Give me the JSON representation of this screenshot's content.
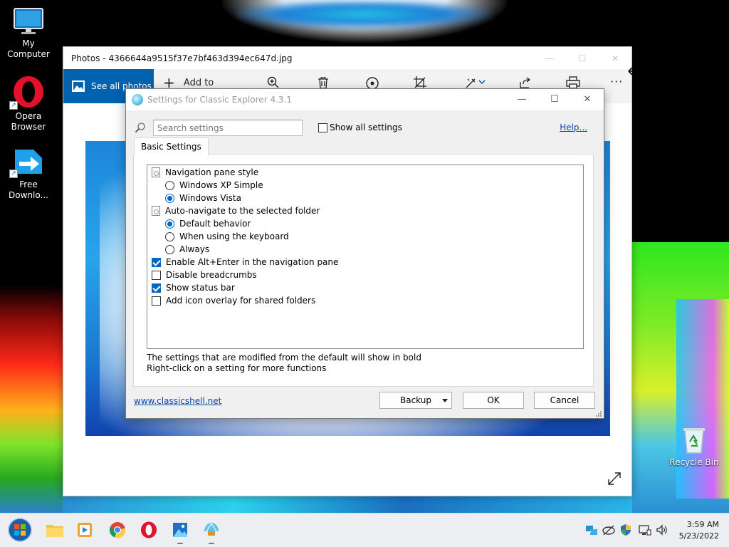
{
  "desktop": {
    "icons": [
      {
        "label": "My Computer",
        "icon": "monitor-icon"
      },
      {
        "label": "Opera Browser",
        "icon": "opera-icon"
      },
      {
        "label": "Free Downlo...",
        "icon": "download-manager-icon"
      },
      {
        "label": "Recycle Bin",
        "icon": "recycle-bin-icon"
      }
    ]
  },
  "photos": {
    "title": "Photos - 4366644a9515f37e7bf463d394ec647d.jpg",
    "see_all": "See all photos",
    "add_to": "Add to",
    "toolbar_icons": [
      "zoom-in-icon",
      "delete-icon",
      "enhance-icon",
      "crop-icon",
      "edit-icon",
      "share-icon",
      "print-icon",
      "more-icon"
    ],
    "more": "···"
  },
  "settings": {
    "title": "Settings for Classic Explorer 4.3.1",
    "search_placeholder": "Search settings",
    "show_all": "Show all settings",
    "help": "Help...",
    "tab": "Basic Settings",
    "tree": [
      {
        "type": "group",
        "label": "Navigation pane style"
      },
      {
        "type": "radio",
        "label": "Windows XP Simple",
        "checked": false
      },
      {
        "type": "radio",
        "label": "Windows Vista",
        "checked": true
      },
      {
        "type": "group",
        "label": "Auto-navigate to the selected folder"
      },
      {
        "type": "radio",
        "label": "Default behavior",
        "checked": true
      },
      {
        "type": "radio",
        "label": "When using the keyboard",
        "checked": false
      },
      {
        "type": "radio",
        "label": "Always",
        "checked": false
      },
      {
        "type": "check",
        "label": "Enable Alt+Enter in the navigation pane",
        "checked": true
      },
      {
        "type": "check",
        "label": "Disable breadcrumbs",
        "checked": false
      },
      {
        "type": "check",
        "label": "Show status bar",
        "checked": true
      },
      {
        "type": "check",
        "label": "Add icon overlay for shared folders",
        "checked": false
      }
    ],
    "info1": "The settings that are modified from the default will show in bold",
    "info2": "Right-click on a setting for more functions",
    "link": "www.classicshell.net",
    "backup": "Backup",
    "ok": "OK",
    "cancel": "Cancel"
  },
  "taskbar": {
    "apps": [
      "start-orb-icon",
      "file-explorer-icon",
      "media-player-icon",
      "chrome-icon",
      "opera-icon",
      "photos-icon",
      "classic-shell-icon"
    ],
    "tray": [
      "sync-icon",
      "network-icon",
      "security-icon",
      "display-icon",
      "volume-icon"
    ],
    "time": "3:59 AM",
    "date": "5/23/2022"
  }
}
